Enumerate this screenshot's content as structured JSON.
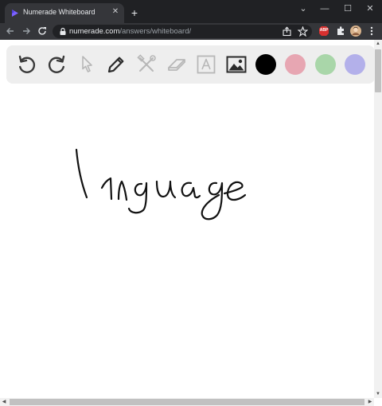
{
  "browser": {
    "tab": {
      "title": "Numerade Whiteboard",
      "close_glyph": "✕",
      "favicon": "numerade-play-icon"
    },
    "new_tab_glyph": "+",
    "window_controls": {
      "dropdown_glyph": "⌄",
      "minimize_glyph": "—",
      "maximize_glyph": "☐",
      "close_glyph": "✕"
    },
    "address": {
      "domain": "numerade.com",
      "path": "/answers/whiteboard/"
    },
    "extension_badge": "ABP"
  },
  "whiteboard": {
    "tools": [
      "undo-icon",
      "redo-icon",
      "pointer-icon",
      "pen-icon",
      "tools-icon",
      "eraser-icon",
      "text-icon",
      "image-icon"
    ],
    "colors": [
      {
        "name": "black",
        "hex": "#000000",
        "selected": true
      },
      {
        "name": "pink",
        "hex": "#e7a6b2",
        "selected": false
      },
      {
        "name": "green",
        "hex": "#a9d6a9",
        "selected": false
      },
      {
        "name": "purple",
        "hex": "#b3b0ea",
        "selected": false
      }
    ],
    "handwriting": "language"
  },
  "theme": {
    "browser_dark": "#202124",
    "toolbar_dark": "#35363a",
    "accent_purple": "#7b61ff"
  }
}
